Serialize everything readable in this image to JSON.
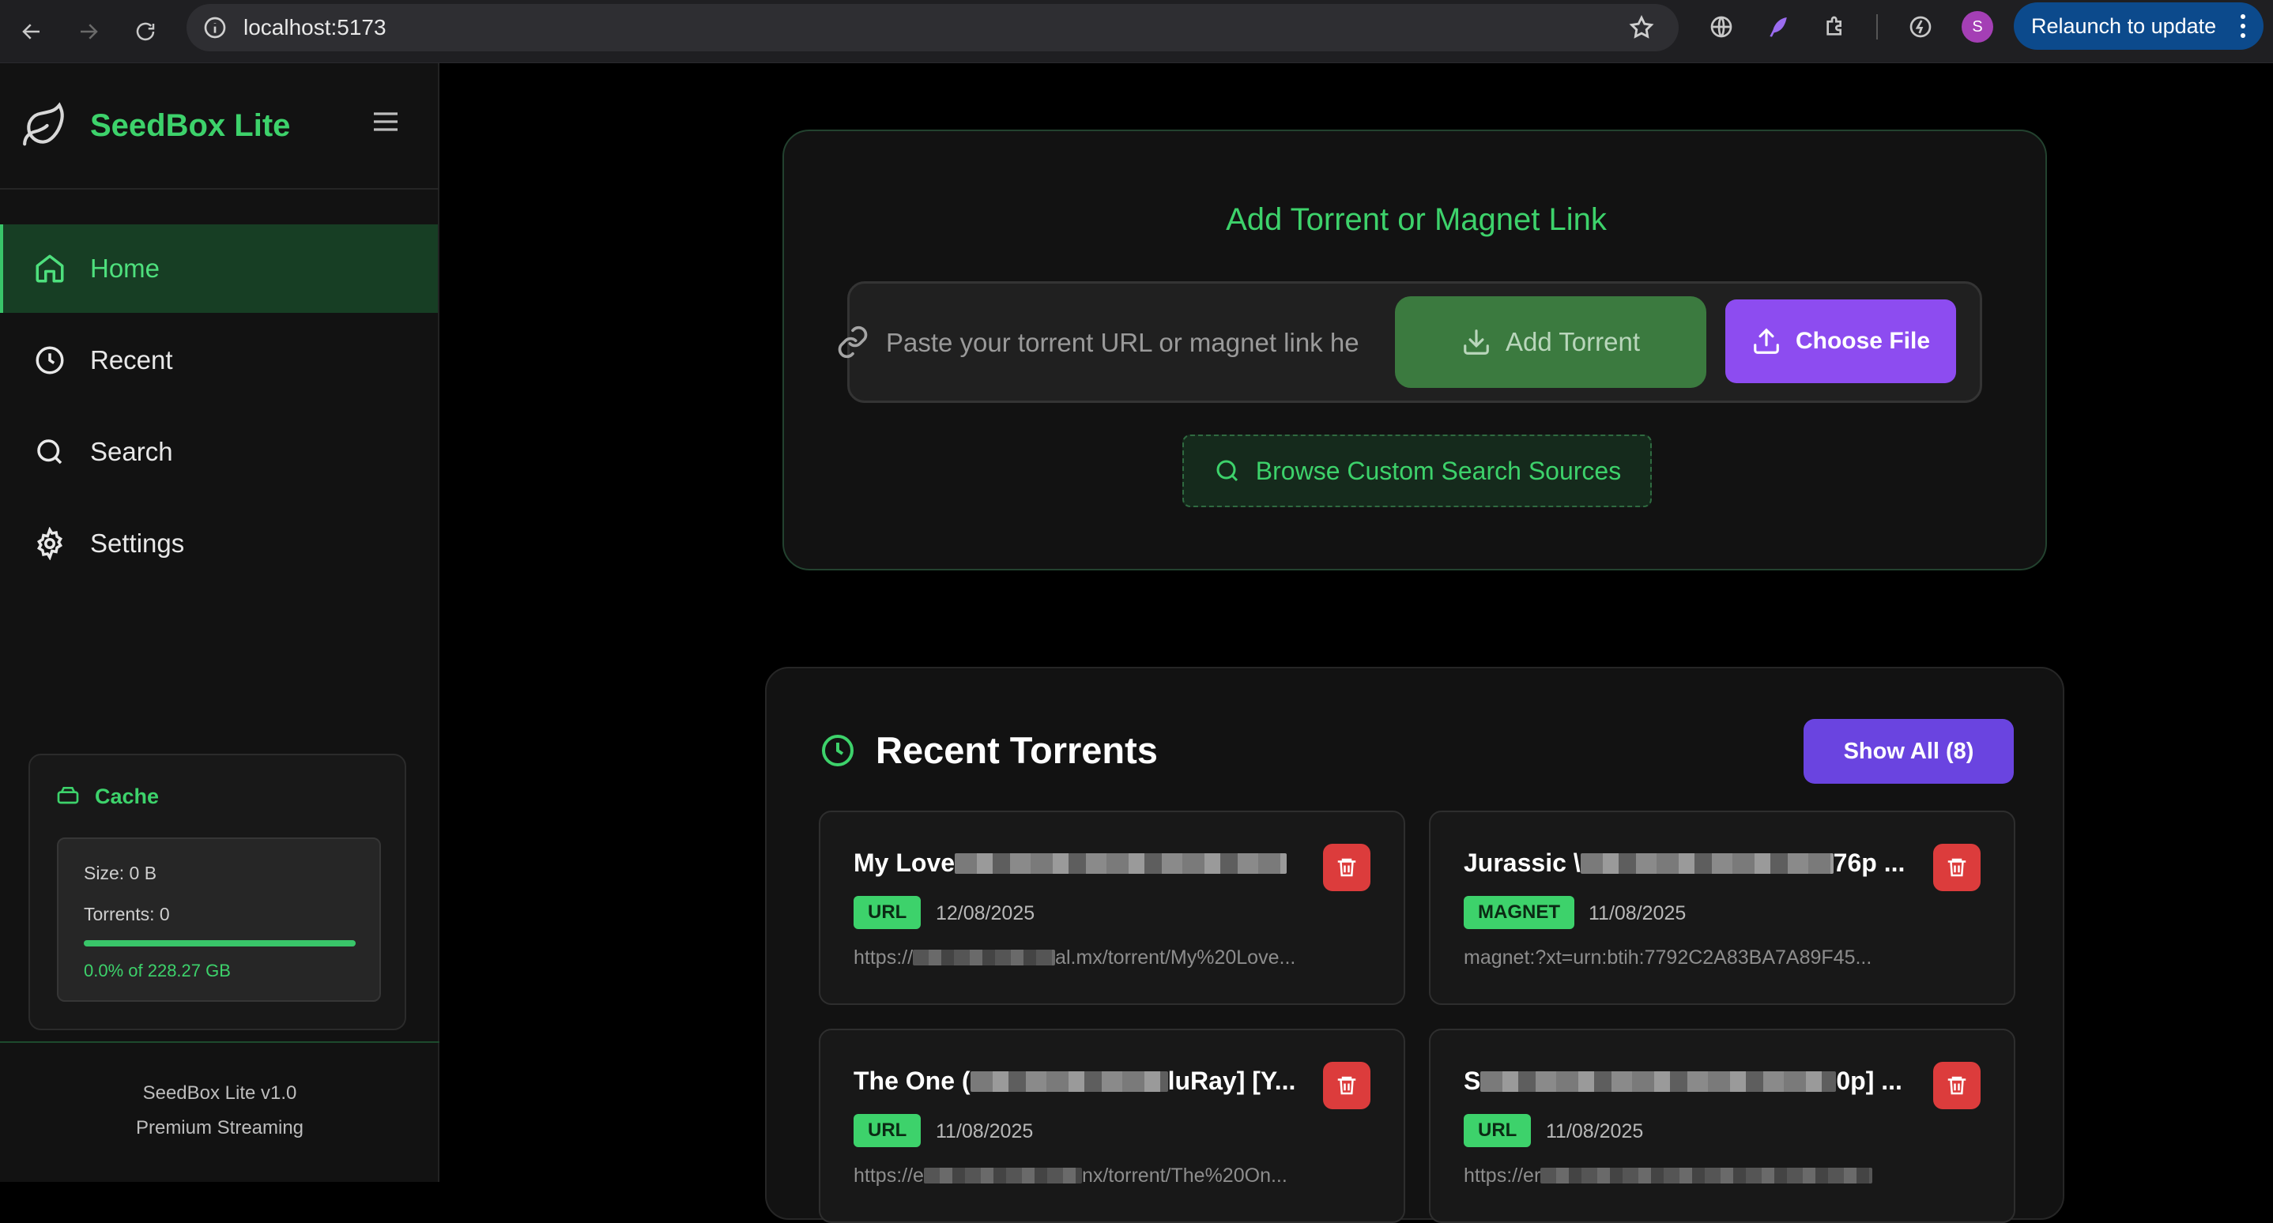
{
  "browser": {
    "url": "localhost:5173",
    "profile_initial": "S",
    "relaunch_label": "Relaunch to update"
  },
  "sidebar": {
    "brand": "SeedBox Lite",
    "nav": [
      {
        "label": "Home",
        "icon": "home-icon",
        "active": true
      },
      {
        "label": "Recent",
        "icon": "clock-icon",
        "active": false
      },
      {
        "label": "Search",
        "icon": "search-icon",
        "active": false
      },
      {
        "label": "Settings",
        "icon": "gear-icon",
        "active": false
      }
    ],
    "cache": {
      "title": "Cache",
      "size": "Size: 0 B",
      "torrents": "Torrents: 0",
      "usage_fraction": 0.0,
      "usage_text": "0.0% of 228.27 GB"
    },
    "footer_version": "SeedBox Lite v1.0",
    "footer_tagline": "Premium Streaming"
  },
  "add_torrent": {
    "title": "Add Torrent or Magnet Link",
    "input_placeholder": "Paste your torrent URL or magnet link here...",
    "add_button": "Add Torrent",
    "file_button": "Choose File",
    "browse_button": "Browse Custom Search Sources"
  },
  "recent": {
    "title": "Recent Torrents",
    "show_all": "Show All (8)",
    "items": [
      {
        "name_prefix": "My Love",
        "name_suffix": "",
        "type": "URL",
        "date": "12/08/2025",
        "url_prefix": "https://",
        "url_suffix": "al.mx/torrent/My%20Love..."
      },
      {
        "name_prefix": "Jurassic \\",
        "name_suffix": "76p ...",
        "type": "MAGNET",
        "date": "11/08/2025",
        "url_prefix": "magnet:?xt=urn:btih:7792C2A83BA7A89F45...",
        "url_suffix": ""
      },
      {
        "name_prefix": "The One (",
        "name_suffix": "luRay] [Y...",
        "type": "URL",
        "date": "11/08/2025",
        "url_prefix": "https://e",
        "url_suffix": "nx/torrent/The%20On..."
      },
      {
        "name_prefix": "S",
        "name_suffix": "0p] ...",
        "type": "URL",
        "date": "11/08/2025",
        "url_prefix": "https://er",
        "url_suffix": ""
      }
    ]
  },
  "colors": {
    "accent_green": "#3dd26b",
    "purple": "#8d4cf0",
    "danger": "#dc3c3c"
  }
}
